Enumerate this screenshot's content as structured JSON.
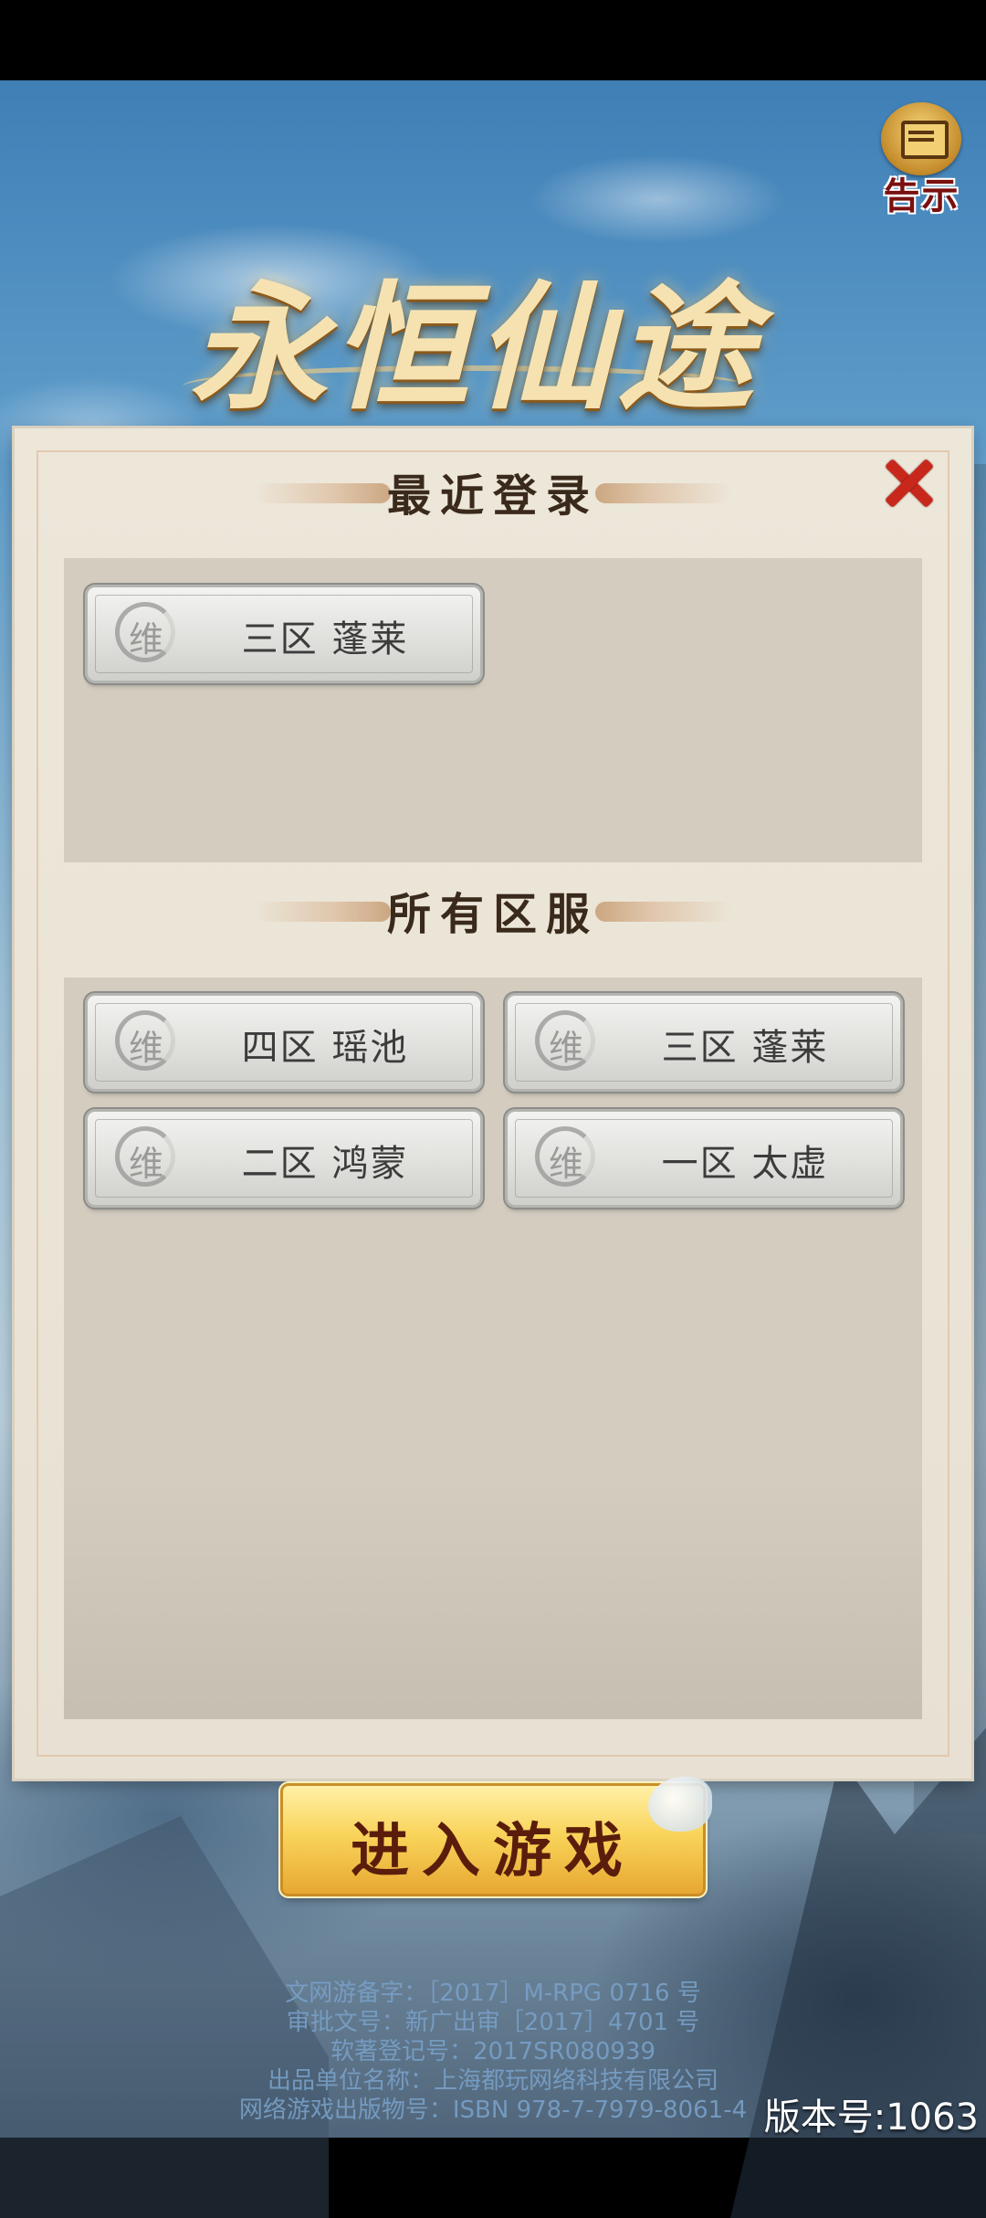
{
  "notice": {
    "label": "告示",
    "icon": "scroll-icon"
  },
  "logo": {
    "title": "永恒仙途"
  },
  "panel": {
    "close_icon": "close-icon",
    "recent_title": "最近登录",
    "all_title": "所有区服",
    "recent_servers": [
      {
        "status_glyph": "维",
        "name": "三区 蓬莱"
      }
    ],
    "all_servers": [
      {
        "status_glyph": "维",
        "name": "四区 瑶池"
      },
      {
        "status_glyph": "维",
        "name": "三区 蓬莱"
      },
      {
        "status_glyph": "维",
        "name": "二区 鸿蒙"
      },
      {
        "status_glyph": "维",
        "name": "一区 太虚"
      }
    ]
  },
  "start_button": {
    "label": "进入游戏"
  },
  "credits": {
    "line1": "文网游备字：［2017］M-RPG 0716 号",
    "line2": "审批文号：新广出审［2017］4701 号",
    "line3": "软著登记号：2017SR080939",
    "line4": "出品单位名称：上海都玩网络科技有限公司",
    "line5": "网络游戏出版物号：ISBN 978-7-7979-8061-4"
  },
  "version": "版本号:1063",
  "colors": {
    "close_red": "#c8281c",
    "start_gold": "#f9d45a",
    "panel_bg": "#ede7da",
    "server_area_bg": "#d3ccbf"
  }
}
